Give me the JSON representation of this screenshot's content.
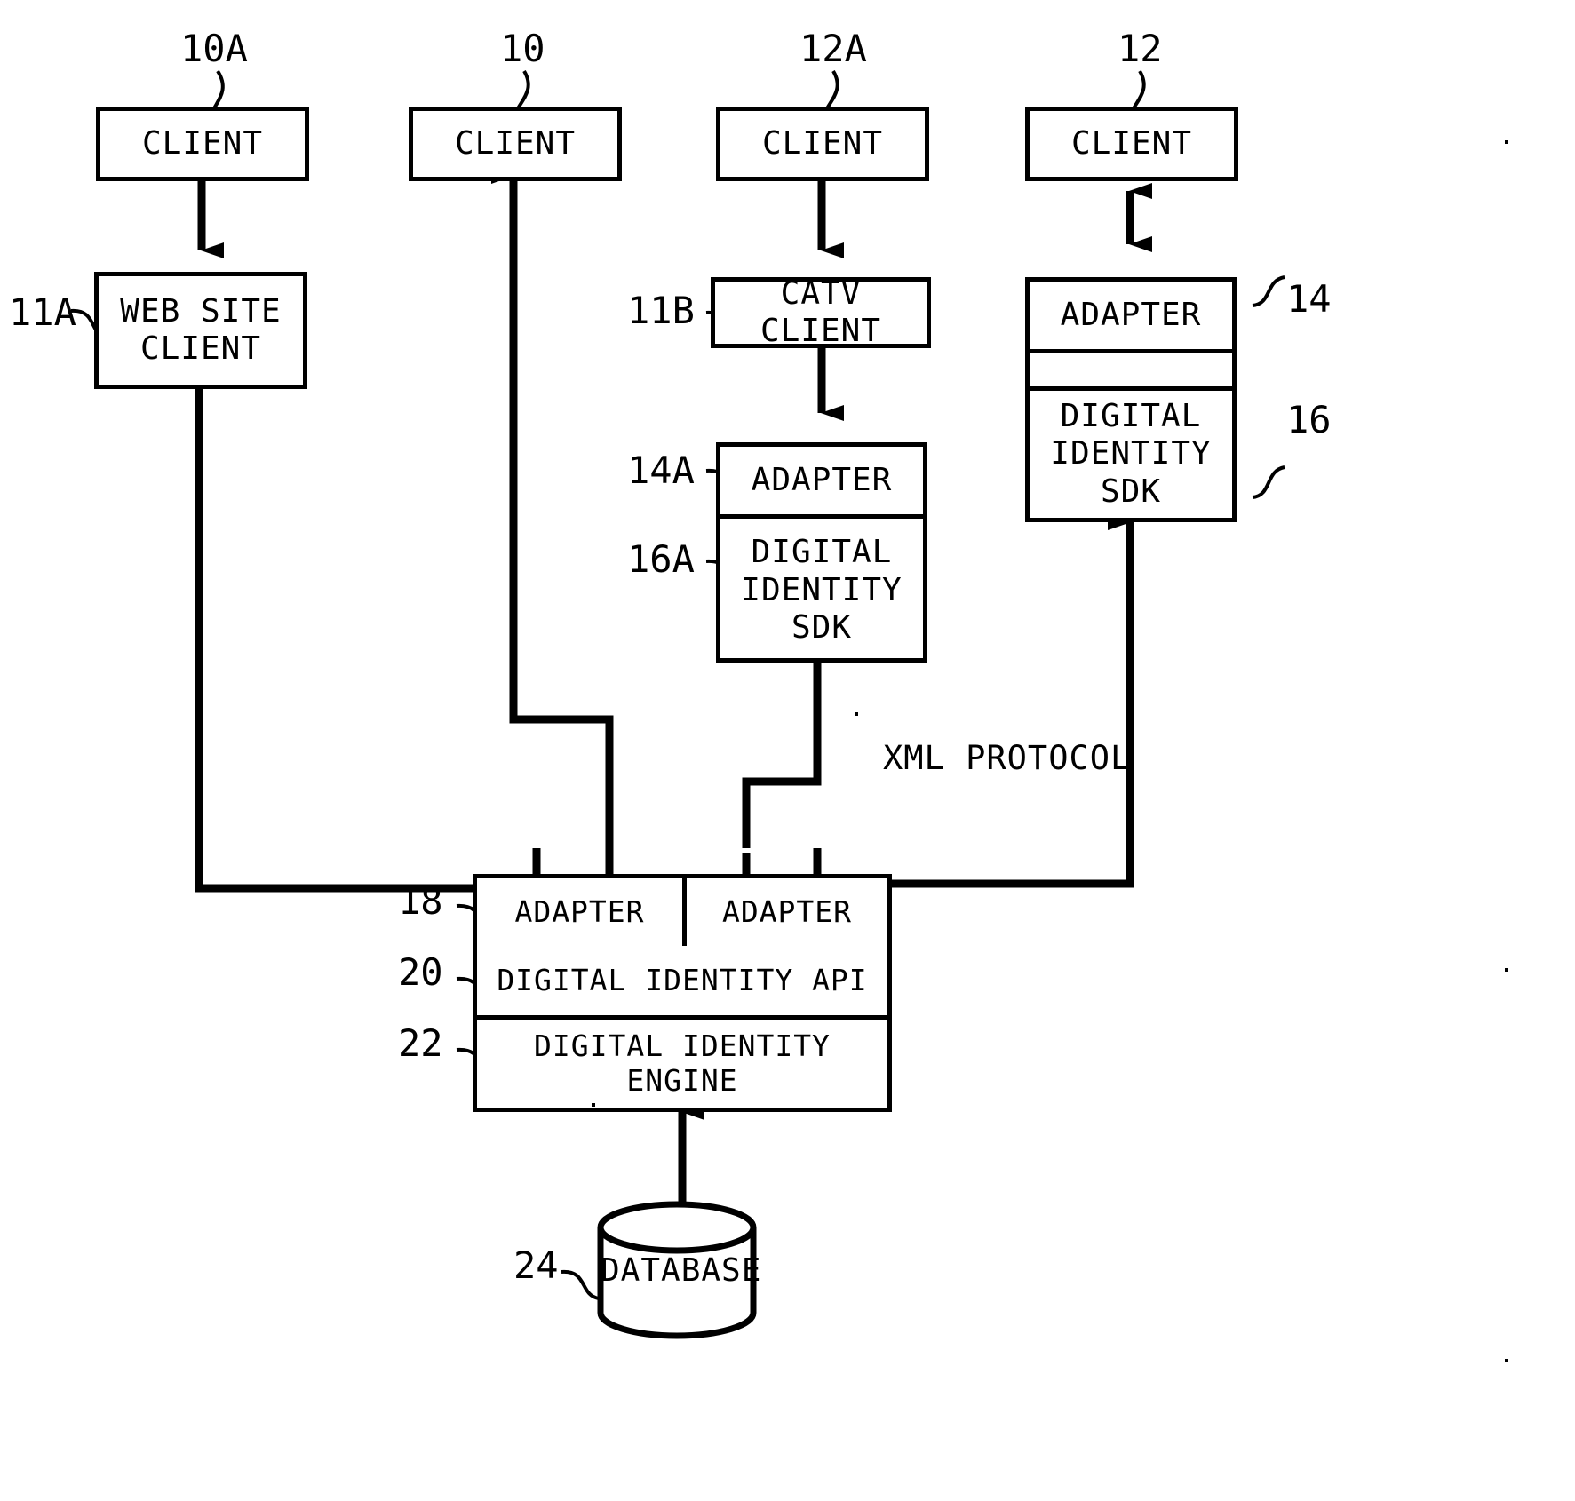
{
  "figure": {
    "title": "Digital identity system block diagram",
    "ink_color": "#000000",
    "background_color": "#ffffff"
  },
  "nodes": {
    "client_10a": {
      "label": "CLIENT",
      "ref": "10A"
    },
    "client_10": {
      "label": "CLIENT",
      "ref": "10"
    },
    "client_12a": {
      "label": "CLIENT",
      "ref": "12A"
    },
    "client_12": {
      "label": "CLIENT",
      "ref": "12"
    },
    "web_site_client": {
      "label": "WEB SITE\nCLIENT",
      "ref": "11A"
    },
    "catv_client": {
      "label": "CATV CLIENT",
      "ref": "11B"
    },
    "client_adapter_mid": {
      "label": "ADAPTER",
      "ref": "14A"
    },
    "client_sdk_mid": {
      "label": "DIGITAL\nIDENTITY\nSDK",
      "ref": "16A"
    },
    "client_adapter_right": {
      "label": "ADAPTER",
      "ref": "14"
    },
    "client_sdk_right": {
      "label": "DIGITAL\nIDENTITY\nSDK",
      "ref": "16"
    },
    "server_adapter_left": {
      "label": "ADAPTER",
      "ref": "18"
    },
    "server_adapter_right": {
      "label": "ADAPTER",
      "ref": "18"
    },
    "digital_identity_api": {
      "label": "DIGITAL IDENTITY API",
      "ref": "20"
    },
    "digital_identity_engine": {
      "label": "DIGITAL IDENTITY ENGINE",
      "ref": "22"
    },
    "database": {
      "label": "DATABASE",
      "ref": "24"
    }
  },
  "annotations": {
    "xml_protocol": "XML PROTOCOL"
  },
  "reference_numerals": {
    "n10a": "10A",
    "n10": "10",
    "n12a": "12A",
    "n12": "12",
    "n11a": "11A",
    "n11b": "11B",
    "n14a": "14A",
    "n16a": "16A",
    "n14": "14",
    "n16": "16",
    "n18": "18",
    "n20": "20",
    "n22": "22",
    "n24": "24"
  }
}
